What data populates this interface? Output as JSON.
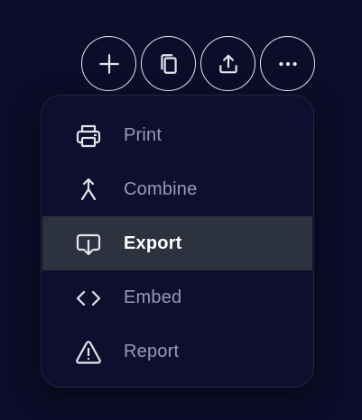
{
  "toolbar": {
    "buttons": [
      {
        "icon": "plus-icon"
      },
      {
        "icon": "copy-icon"
      },
      {
        "icon": "share-upload-icon"
      },
      {
        "icon": "more-horizontal-icon"
      }
    ]
  },
  "menu": {
    "items": [
      {
        "label": "Print",
        "icon": "printer-icon",
        "active": false
      },
      {
        "label": "Combine",
        "icon": "merge-icon",
        "active": false
      },
      {
        "label": "Export",
        "icon": "export-download-icon",
        "active": true
      },
      {
        "label": "Embed",
        "icon": "code-embed-icon",
        "active": false
      },
      {
        "label": "Report",
        "icon": "warning-triangle-icon",
        "active": false
      }
    ]
  },
  "colors": {
    "background": "#0d0d2b",
    "menu_background": "#0e0e2e",
    "active_row": "#2d323f",
    "label": "#9a9ab4",
    "label_active": "#ffffff",
    "icon": "#e4e4ec"
  }
}
